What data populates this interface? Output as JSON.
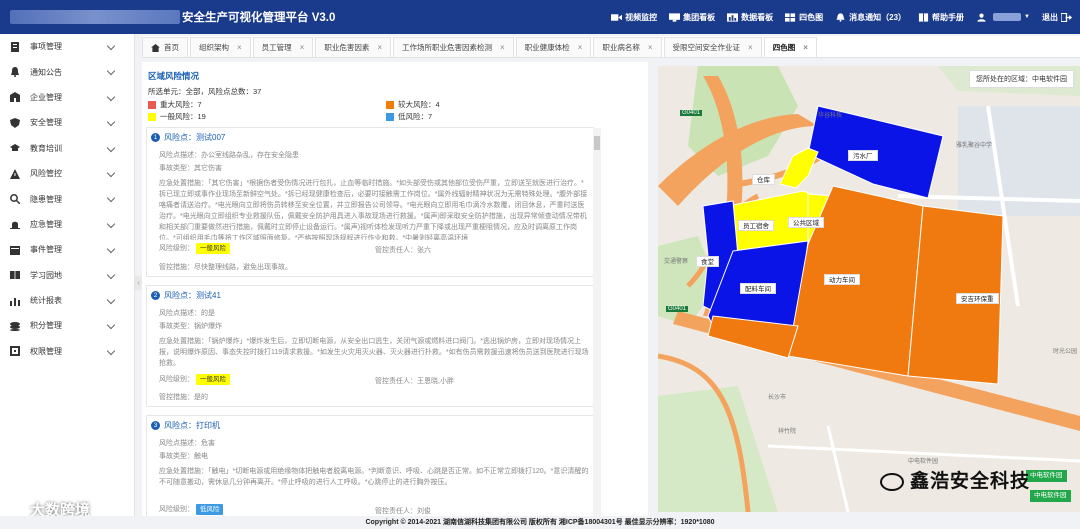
{
  "header": {
    "title": "安全生产可视化管理平台  V3.0",
    "nav": [
      {
        "label": "视频监控",
        "icon": "video-camera-icon"
      },
      {
        "label": "集团看板",
        "icon": "dashboard-icon"
      },
      {
        "label": "数据看板",
        "icon": "bar-chart-icon"
      },
      {
        "label": "四色图",
        "icon": "grid-icon"
      },
      {
        "label": "消息通知（23）",
        "icon": "bell-icon"
      },
      {
        "label": "帮助手册",
        "icon": "book-icon"
      },
      {
        "label": "",
        "icon": "user-icon"
      },
      {
        "label": "退出",
        "icon": "logout-icon"
      }
    ]
  },
  "sidebar": {
    "items": [
      {
        "label": "事项管理",
        "icon": "checklist-icon"
      },
      {
        "label": "通知公告",
        "icon": "bell-icon"
      },
      {
        "label": "企业管理",
        "icon": "building-icon"
      },
      {
        "label": "安全管理",
        "icon": "shield-icon"
      },
      {
        "label": "教育培训",
        "icon": "graduation-cap-icon"
      },
      {
        "label": "风险管控",
        "icon": "warning-icon"
      },
      {
        "label": "隐患管理",
        "icon": "search-icon"
      },
      {
        "label": "应急管理",
        "icon": "siren-icon"
      },
      {
        "label": "事件管理",
        "icon": "event-icon"
      },
      {
        "label": "学习园地",
        "icon": "book-icon"
      },
      {
        "label": "统计报表",
        "icon": "report-icon"
      },
      {
        "label": "积分管理",
        "icon": "coins-icon"
      },
      {
        "label": "权限管理",
        "icon": "key-icon"
      }
    ]
  },
  "tabs": [
    {
      "label": "首页",
      "home": true
    },
    {
      "label": "组织架构"
    },
    {
      "label": "员工管理"
    },
    {
      "label": "职业危害因素"
    },
    {
      "label": "工作场所职业危害因素检测"
    },
    {
      "label": "职业健康体检"
    },
    {
      "label": "职业病名称"
    },
    {
      "label": "受限空间安全作业证"
    },
    {
      "label": "四色图",
      "active": true
    }
  ],
  "panel": {
    "title": "区域风险情况",
    "summary": "所选单元：全部，风险点总数：37",
    "legend": [
      {
        "label": "重大风险：7",
        "color": "#e85a4f"
      },
      {
        "label": "较大风险：4",
        "color": "#ef7d0b"
      },
      {
        "label": "一般风险：19",
        "color": "#ffff00"
      },
      {
        "label": "低风险：7",
        "color": "#3b9ae1"
      }
    ],
    "labels": {
      "point": "风险点：",
      "desc": "风险点描述：",
      "type": "事故类型：",
      "measure": "应急处置措施：",
      "level": "风险级别：",
      "owner": "管控责任人：",
      "control": "管控措施："
    },
    "cards": [
      {
        "num": "1",
        "name": "测试007",
        "desc": "办公室线路杂乱，存在安全隐患",
        "type": "其它伤害",
        "measure": "「其它伤害」*根据伤者受伤情况进行包扎，止血等临时措施。*如头部受伤或其他部位受伤严重，立即送至就医进行治疗。*拆已现立即或事作业现场至新鲜空气处。*拆已经现健康检查后，必要时接触需工作岗位。*属外线辐射精神状况为无需特殊处理。*腹外部接咯痛者请送治疗。*电光眼向立即将伤员转移至安全位置，并立即报告公司领导。*电光眼向立即用毛巾滴冷水数覆，闭目休息，严重时送医治疗。*电光眼向立即组织专业救援队伍，佩戴安全防护用具进入事故现场进行救援。*属声)即采取安全防护措施，出现异常倾查动情况带机和相关部门重要做然进行措施，佩戴时立即停止设备运行。*属声)视听体检发现听力严重下降或出现严重梗阻情况，应及时调离原工作岗位。*可组织用毛巾等将工作区域照面修复。*严格按照现场规程进行作业和救。*中暑则轻离高温环境",
        "level": "一般风险",
        "level_style": "yellow",
        "owner": "张六",
        "control": "尽快整理线路，避免出现事故。"
      },
      {
        "num": "2",
        "name": "测试41",
        "desc": "的是",
        "type": "锅炉爆炸",
        "measure": "「锅炉爆炸」*爆炸发生后，立即切断电源，从安全出口逃生，关闭气源或燃料进口阀门。*逃出锅炉房，立即对现场情况上报，说明爆炸原因、事态失控时拨打119请求救援。*如发生火灾用灭火器、灭火器进行扑救。*如有伤员需救援迅速将伤员送到医院进行现场抢救。",
        "level": "一般风险",
        "level_style": "yellow",
        "owner": "王恩晓,小胖",
        "control": "是的"
      },
      {
        "num": "3",
        "name": "打印机",
        "desc": "危害",
        "type": "触电",
        "measure": "「触电」*切断电源或用绝缘物体把触电者脱离电源。*判断意识、呼吸、心跳是否正常。如不正常立即拨打120。*意识清醒的不可随意搬动，需休息几分钟再离开。*停止呼吸的进行人工呼吸。*心跳停止的进行胸外按压。",
        "level": "低风险",
        "level_style": "blue",
        "owner": "刘俊",
        "control": ""
      }
    ]
  },
  "map": {
    "location_text": "您所处在的区域：中电软件园",
    "areas": [
      {
        "label": "污水厂",
        "color": "#0a14e6"
      },
      {
        "label": "仓库",
        "color": "#ffff00"
      },
      {
        "label": "员工宿舍",
        "color": "#ffff00"
      },
      {
        "label": "公共区域",
        "color": "#ffff00"
      },
      {
        "label": "食堂",
        "color": "#0a14e6"
      },
      {
        "label": "配料车间",
        "color": "#0a14e6"
      },
      {
        "label": "动力车间",
        "color": "#f07a10"
      },
      {
        "label": "安吉环保重",
        "color": "#f07a10"
      }
    ],
    "pois": [
      "华谷科技",
      "雅乳聚谷中学",
      "G0401",
      "G0401",
      "中电软件园",
      "交通警察",
      "长沙市",
      "时光公园",
      "祥竹院"
    ],
    "buttons": [
      "中电软件园",
      "中电软件园"
    ]
  },
  "watermarks": {
    "right": "鑫浩安全科技",
    "left": "大数跨境"
  },
  "footer": "Copyright © 2014-2021 湖南信湖科技集团有限公司 版权所有 湘ICP备18004301号 最佳显示分辨率：1920*1080",
  "colors": {
    "header": "#1a3a8c",
    "accent": "#1a5fb4",
    "major": "#e85a4f",
    "large": "#ef7d0b",
    "normal": "#ffff00",
    "low": "#3b9ae1"
  }
}
